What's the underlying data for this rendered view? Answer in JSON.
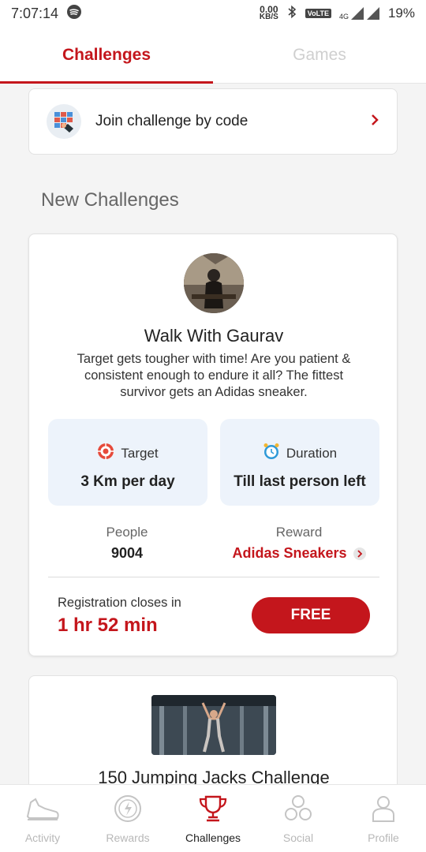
{
  "status_bar": {
    "time": "7:07:14",
    "net_speed_value": "0.00",
    "net_speed_unit": "KB/S",
    "volte": "VoLTE",
    "network": "4G",
    "battery": "19%"
  },
  "tabs": [
    {
      "label": "Challenges",
      "active": true
    },
    {
      "label": "Games",
      "active": false
    }
  ],
  "join": {
    "label": "Join challenge by code"
  },
  "section_title": "New Challenges",
  "challenge": {
    "title": "Walk With Gaurav",
    "description": "Target gets tougher with time! Are you patient & consistent enough to endure it all? The fittest survivor gets an Adidas sneaker.",
    "target_label": "Target",
    "target_value": "3 Km per day",
    "duration_label": "Duration",
    "duration_value": "Till last person left",
    "people_label": "People",
    "people_value": "9004",
    "reward_label": "Reward",
    "reward_value": "Adidas Sneakers",
    "registration_label": "Registration closes in",
    "registration_time": "1 hr 52 min",
    "free_label": "FREE"
  },
  "challenge2": {
    "title": "150 Jumping Jacks Challenge"
  },
  "bottom_nav": [
    {
      "label": "Activity",
      "icon": "shoe-icon",
      "active": false
    },
    {
      "label": "Rewards",
      "icon": "rewards-icon",
      "active": false
    },
    {
      "label": "Challenges",
      "icon": "trophy-icon",
      "active": true
    },
    {
      "label": "Social",
      "icon": "social-icon",
      "active": false
    },
    {
      "label": "Profile",
      "icon": "profile-icon",
      "active": false
    }
  ],
  "colors": {
    "accent": "#c4161c",
    "stat_bg": "#edf3fb"
  }
}
